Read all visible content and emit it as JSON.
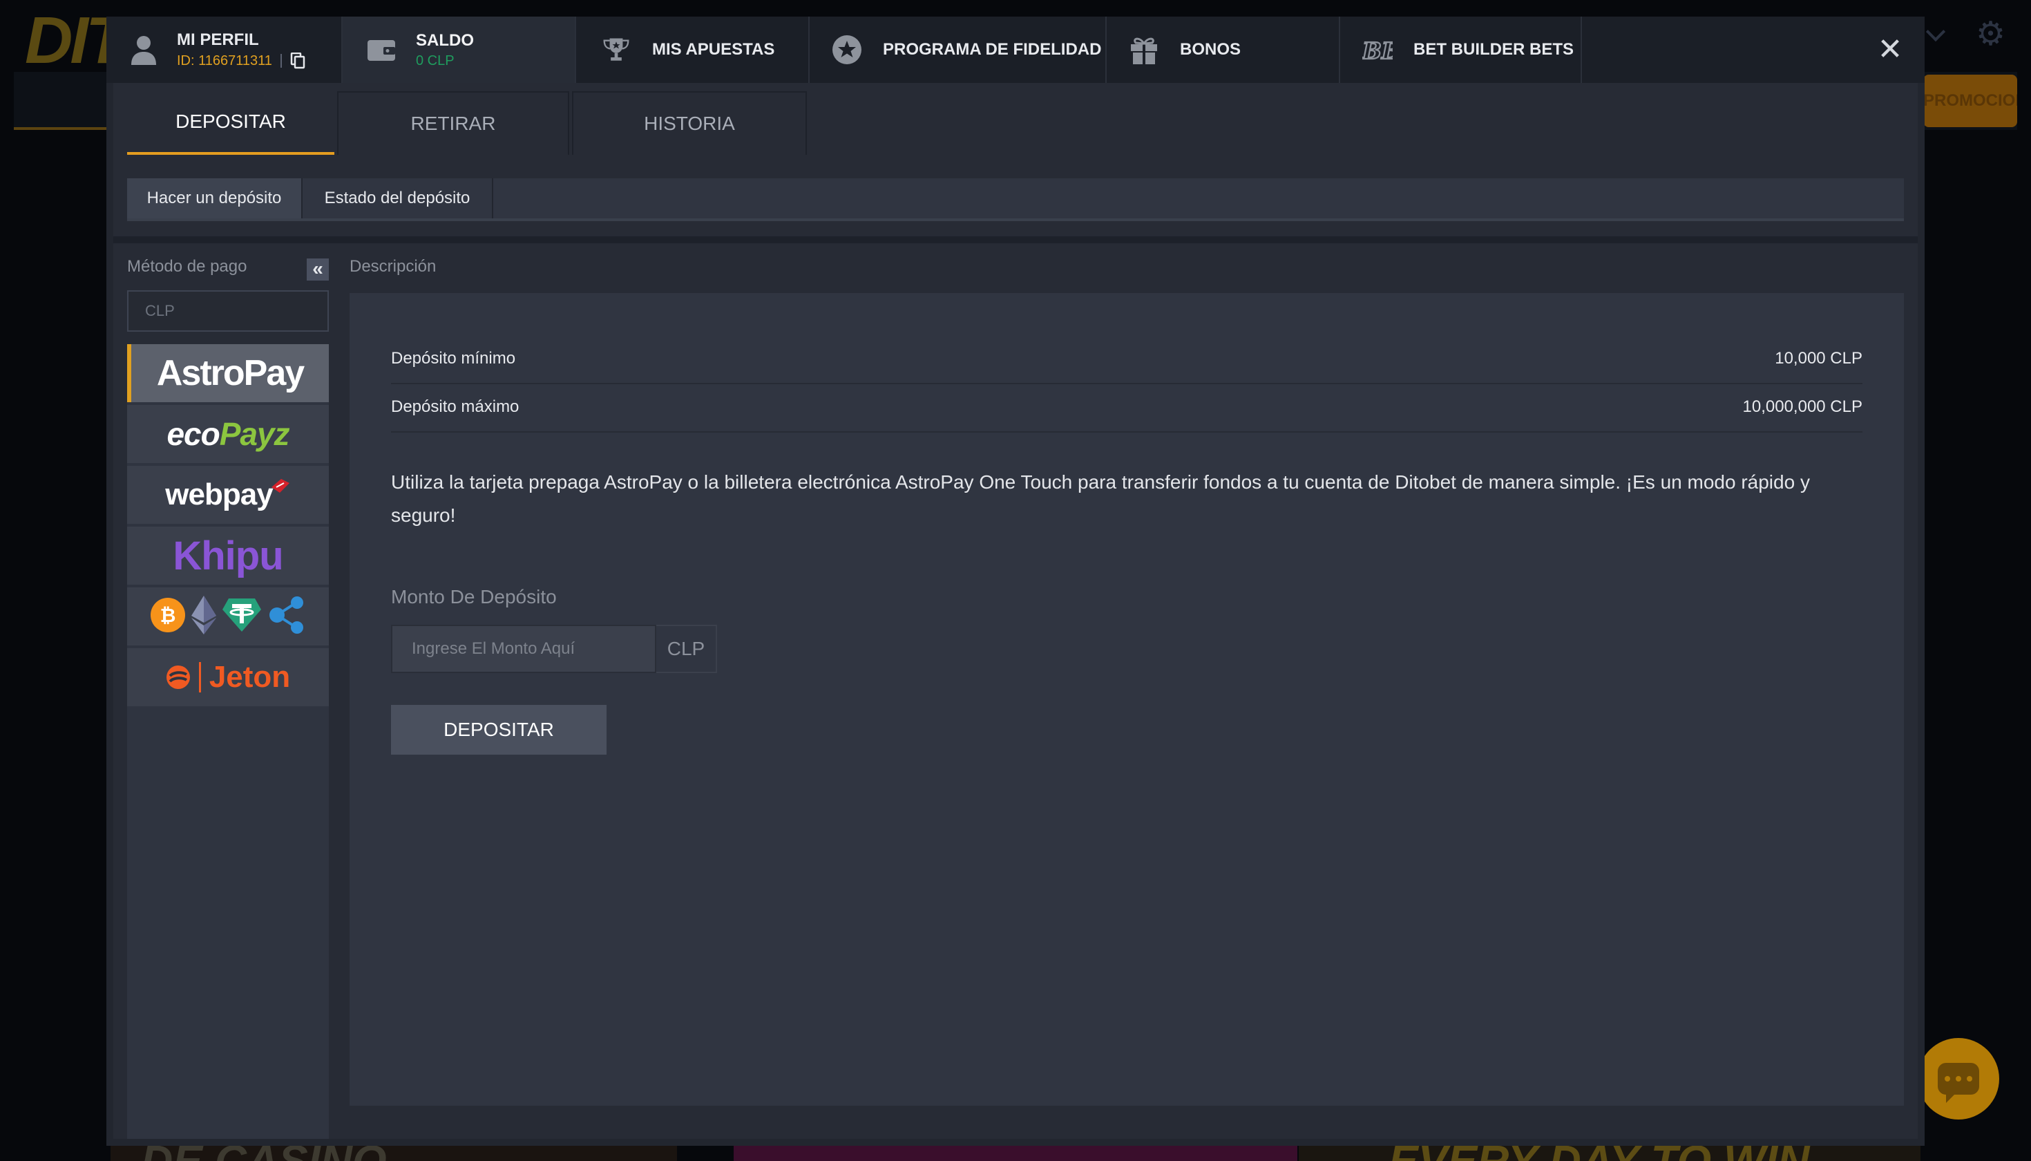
{
  "background": {
    "logo_partial": "DITOBET",
    "promo_button_partial": "PROMOCIONES",
    "banner_texts": [
      "DE CASINO",
      "EVERY DAY TO WIN"
    ]
  },
  "top_nav": {
    "profile": {
      "title": "MI PERFIL",
      "id": "ID: 1166711311",
      "icon": "user-icon",
      "copy_icon": "copy-icon"
    },
    "saldo": {
      "title": "SALDO",
      "value": "0 CLP",
      "icon": "wallet-icon"
    },
    "items": [
      {
        "label": "MIS APUESTAS",
        "icon": "trophy-icon"
      },
      {
        "label": "PROGRAMA DE FIDELIDAD",
        "icon": "star-icon"
      },
      {
        "label": "BONOS",
        "icon": "gift-icon"
      },
      {
        "label": "BET BUILDER BETS",
        "icon": "bb-icon"
      }
    ],
    "close_symbol": "✕"
  },
  "main_tabs": [
    {
      "label": "DEPOSITAR",
      "active": true
    },
    {
      "label": "RETIRAR",
      "active": false
    },
    {
      "label": "HISTORIA",
      "active": false
    }
  ],
  "sub_tabs": [
    {
      "label": "Hacer un depósito",
      "active": true
    },
    {
      "label": "Estado del depósito",
      "active": false
    }
  ],
  "sidebar": {
    "title": "Método de pago",
    "collapse_symbol": "«",
    "currency": "CLP",
    "methods": [
      {
        "name": "AstroPay",
        "active": true
      },
      {
        "name": "ecoPayz"
      },
      {
        "name": "webpay"
      },
      {
        "name": "Khipu"
      },
      {
        "name": "Crypto",
        "icons": [
          "bitcoin-icon",
          "ethereum-icon",
          "tether-icon",
          "ripple-icon"
        ]
      },
      {
        "name": "Jeton"
      }
    ],
    "logo_text": {
      "astropay": "AstroPay",
      "ecopayz_a": "eco",
      "ecopayz_b": "Payz",
      "webpay": "webpay",
      "khipu": "Khipu",
      "jeton": "Jeton"
    }
  },
  "description": {
    "title": "Descripción",
    "min_label": "Depósito mínimo",
    "min_value": "10,000 CLP",
    "max_label": "Depósito máximo",
    "max_value": "10,000,000 CLP",
    "text": "Utiliza la tarjeta prepaga AstroPay o la billetera electrónica AstroPay One Touch para transferir fondos a tu cuenta de Ditobet de manera simple. ¡Es un modo rápido y seguro!",
    "amount_label": "Monto De Depósito",
    "amount_placeholder": "Ingrese El Monto Aquí",
    "amount_currency": "CLP",
    "deposit_button": "DEPOSITAR"
  },
  "colors": {
    "accent": "#e49d20",
    "balance": "#1f9d5e",
    "modal_bg": "#22262f",
    "panel_bg": "#303541"
  }
}
